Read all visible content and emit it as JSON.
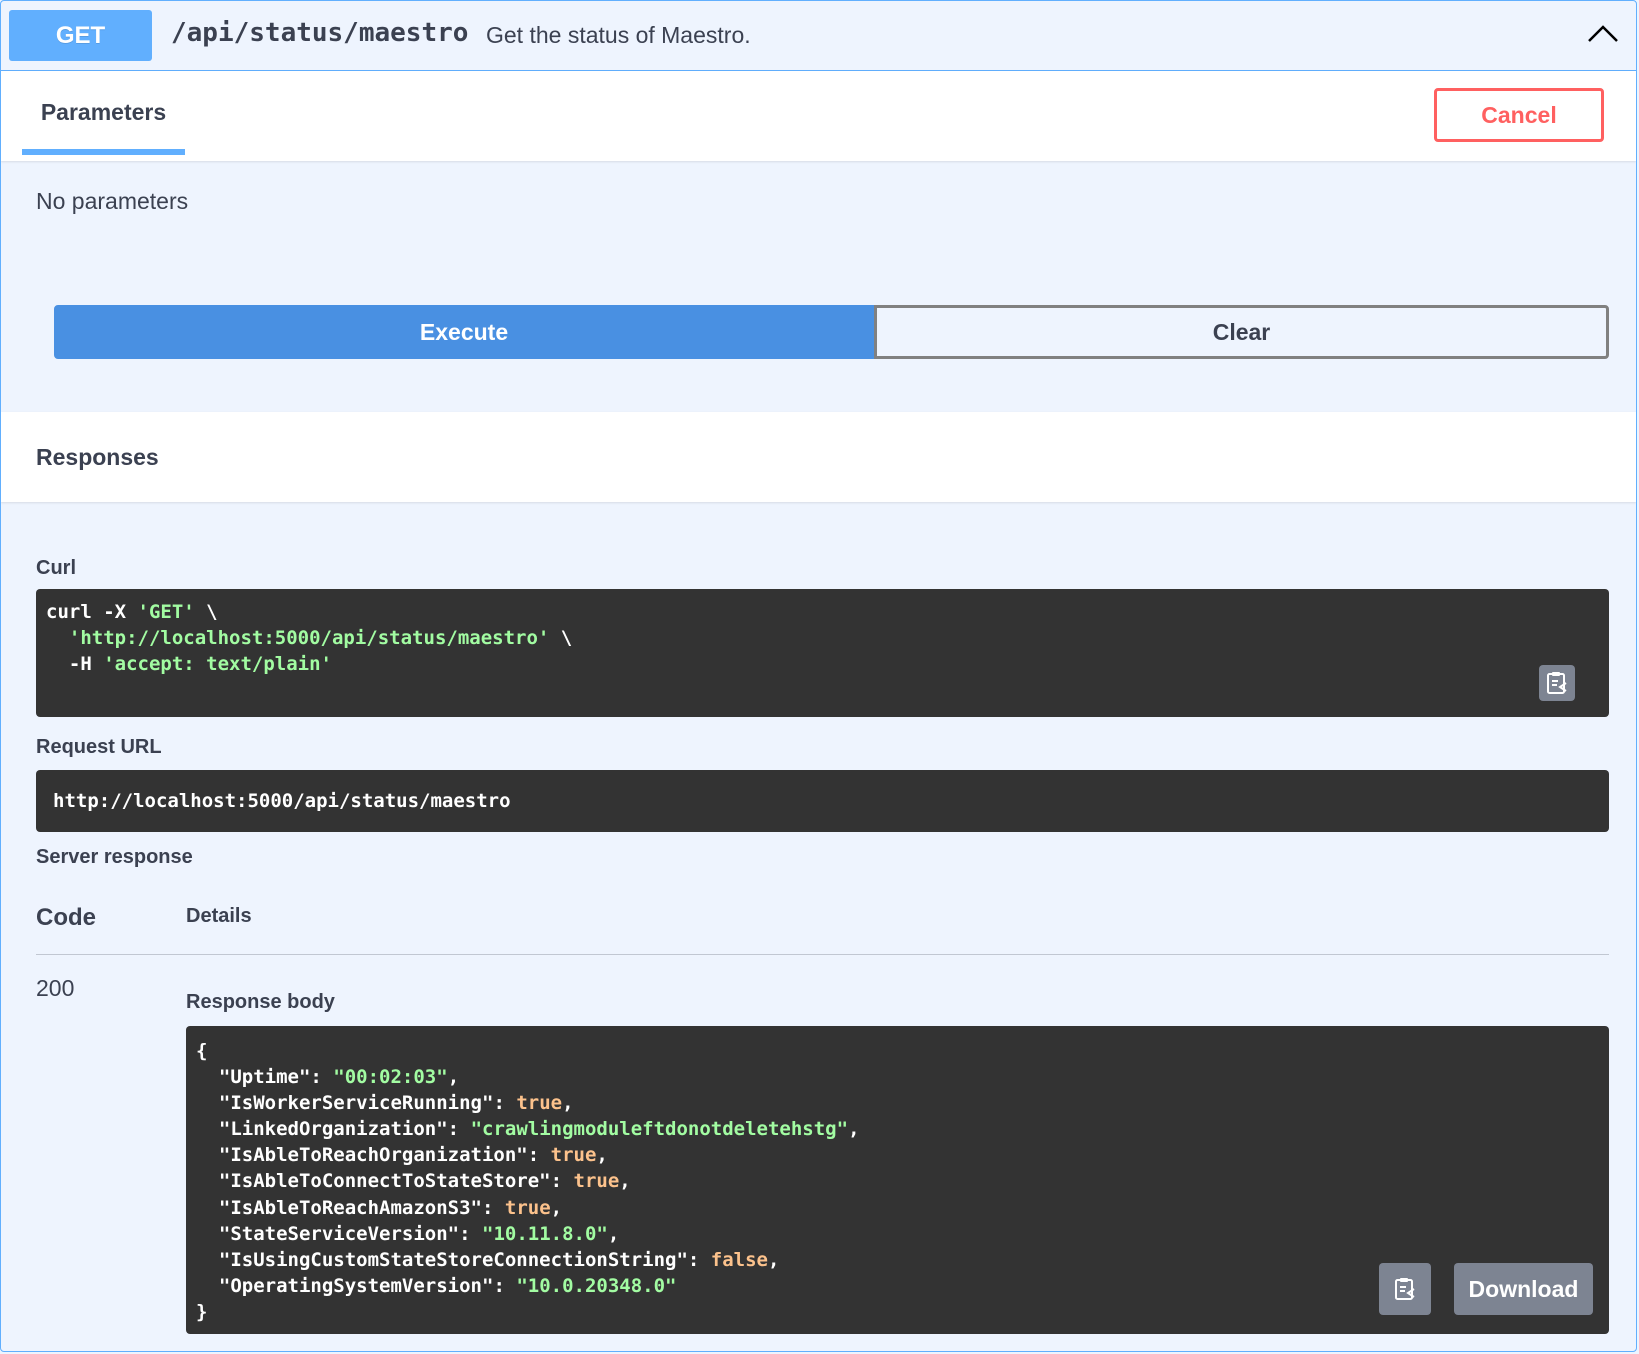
{
  "summary": {
    "method": "GET",
    "path": "/api/status/maestro",
    "description": "Get the status of Maestro."
  },
  "parameters": {
    "tab_label": "Parameters",
    "cancel_label": "Cancel",
    "empty_text": "No parameters"
  },
  "actions": {
    "execute_label": "Execute",
    "clear_label": "Clear"
  },
  "responses": {
    "title": "Responses",
    "curl_label": "Curl",
    "curl": {
      "line1_a": "curl -X ",
      "line1_b": "'GET'",
      "line1_c": " \\",
      "line2_a": "  ",
      "line2_b": "'http://localhost:5000/api/status/maestro'",
      "line2_c": " \\",
      "line3_a": "  -H ",
      "line3_b": "'accept: text/plain'"
    },
    "request_url_label": "Request URL",
    "request_url": "http://localhost:5000/api/status/maestro",
    "server_response_label": "Server response",
    "table_headers": {
      "code": "Code",
      "details": "Details"
    },
    "status_code": "200",
    "response_body_label": "Response body",
    "body": [
      {
        "key": "\"Uptime\"",
        "value": "\"00:02:03\"",
        "type": "str",
        "sep": ","
      },
      {
        "key": "\"IsWorkerServiceRunning\"",
        "value": "true",
        "type": "kw",
        "sep": ","
      },
      {
        "key": "\"LinkedOrganization\"",
        "value": "\"crawlingmoduleftdonotdeletehstg\"",
        "type": "str",
        "sep": ","
      },
      {
        "key": "\"IsAbleToReachOrganization\"",
        "value": "true",
        "type": "kw",
        "sep": ","
      },
      {
        "key": "\"IsAbleToConnectToStateStore\"",
        "value": "true",
        "type": "kw",
        "sep": ","
      },
      {
        "key": "\"IsAbleToReachAmazonS3\"",
        "value": "true",
        "type": "kw",
        "sep": ","
      },
      {
        "key": "\"StateServiceVersion\"",
        "value": "\"10.11.8.0\"",
        "type": "str",
        "sep": ","
      },
      {
        "key": "\"IsUsingCustomStateStoreConnectionString\"",
        "value": "false",
        "type": "kw",
        "sep": ","
      },
      {
        "key": "\"OperatingSystemVersion\"",
        "value": "\"10.0.20348.0\"",
        "type": "str",
        "sep": ""
      }
    ],
    "body_open": "{",
    "body_close": "}",
    "download_label": "Download"
  },
  "icons": {
    "collapse": "chevron-up-icon",
    "copy": "clipboard-copy-icon"
  },
  "colors": {
    "get": "#61affe",
    "execute": "#4990e2",
    "cancel": "#ff6060",
    "string": "#a2fca2",
    "keyword": "#fcc28c"
  }
}
